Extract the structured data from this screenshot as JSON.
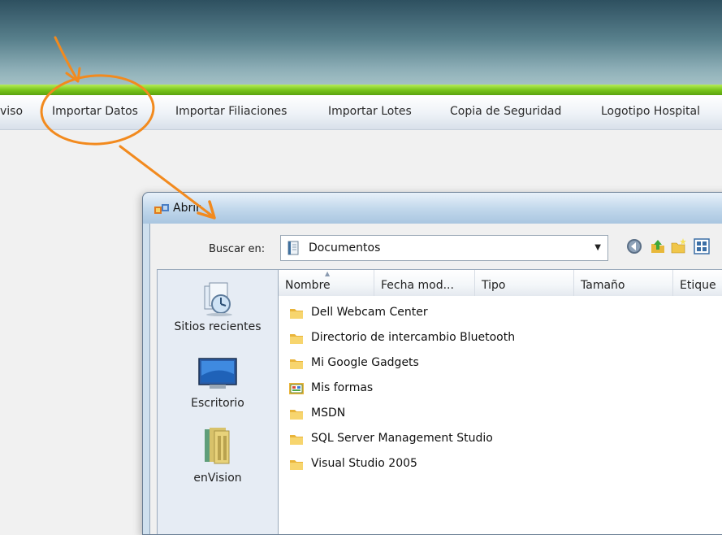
{
  "menu": {
    "items": [
      {
        "label": "viso"
      },
      {
        "label": "Importar Datos"
      },
      {
        "label": "Importar Filiaciones"
      },
      {
        "label": "Importar Lotes"
      },
      {
        "label": "Copia de Seguridad"
      },
      {
        "label": "Logotipo Hospital"
      }
    ]
  },
  "dialog": {
    "title": "Abrir",
    "look_in_label": "Buscar en:",
    "look_in_value": "Documentos",
    "places": [
      {
        "label": "Sitios recientes",
        "icon": "recent-places-icon"
      },
      {
        "label": "Escritorio",
        "icon": "desktop-icon"
      },
      {
        "label": "enVision",
        "icon": "user-folder-icon"
      }
    ],
    "columns": [
      "Nombre",
      "Fecha mod...",
      "Tipo",
      "Tamaño",
      "Etique"
    ],
    "files": [
      {
        "name": "Dell Webcam Center",
        "icon": "folder-icon"
      },
      {
        "name": "Directorio de intercambio Bluetooth",
        "icon": "folder-icon"
      },
      {
        "name": "Mi Google Gadgets",
        "icon": "folder-icon"
      },
      {
        "name": "Mis formas",
        "icon": "special-folder-icon"
      },
      {
        "name": "MSDN",
        "icon": "folder-icon"
      },
      {
        "name": "SQL Server Management Studio",
        "icon": "folder-icon"
      },
      {
        "name": "Visual Studio 2005",
        "icon": "folder-icon"
      }
    ]
  },
  "colors": {
    "annotation": "#f28a1e",
    "accent_green": "#76c319",
    "header_dark": "#2e5060"
  }
}
